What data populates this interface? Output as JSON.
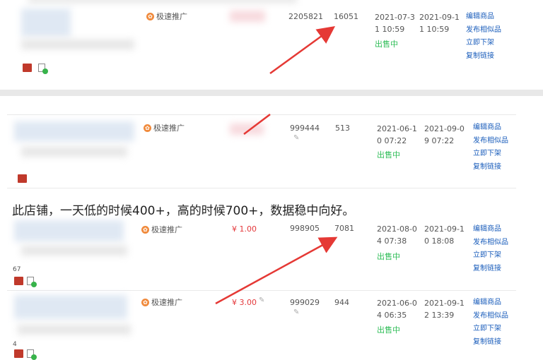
{
  "colors": {
    "accent": "#e4393c",
    "link": "#1a5dbb",
    "status": "#2ebd57",
    "promo": "#f08a3c",
    "arrow": "#e53935"
  },
  "caption": "此店铺，一天低的时候400+，高的时候700+，数据稳中向好。",
  "rows": [
    {
      "promo": "极速推广",
      "price": "",
      "id": "2205821",
      "sales": "16051",
      "created": "2021-07-31 10:59",
      "expire": "2021-09-11 10:59",
      "status": "出售中",
      "actions": [
        "编辑商品",
        "发布相似品",
        "立即下架",
        "复制链接"
      ]
    },
    {
      "promo": "极速推广",
      "price": "",
      "id": "999444",
      "sales": "513",
      "created": "2021-06-10 07:22",
      "expire": "2021-09-09 07:22",
      "status": "出售中",
      "actions": [
        "编辑商品",
        "发布相似品",
        "立即下架",
        "复制链接"
      ]
    },
    {
      "promo": "极速推广",
      "price": "¥ 1.00",
      "id": "998905",
      "sales": "7081",
      "created": "2021-08-04 07:38",
      "expire": "2021-09-10 18:08",
      "status": "出售中",
      "actions": [
        "编辑商品",
        "发布相似品",
        "立即下架",
        "复制链接"
      ],
      "extra": "67"
    },
    {
      "promo": "极速推广",
      "price": "¥ 3.00",
      "id": "999029",
      "sales": "944",
      "created": "2021-06-04 06:35",
      "expire": "2021-09-12 13:39",
      "status": "出售中",
      "actions": [
        "编辑商品",
        "发布相似品",
        "立即下架",
        "复制链接"
      ],
      "extra": "4"
    }
  ]
}
